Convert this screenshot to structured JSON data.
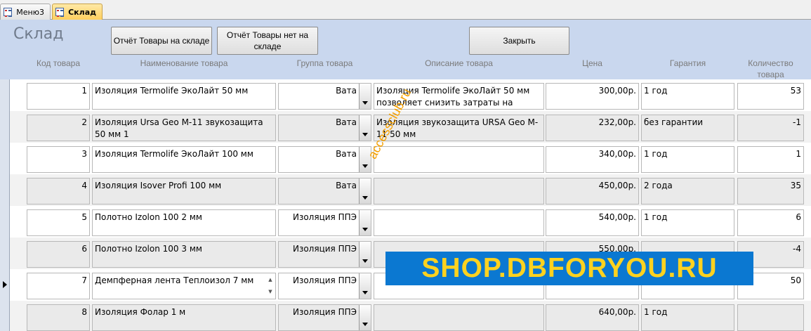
{
  "tabs": [
    {
      "label": "Меню3",
      "active": false
    },
    {
      "label": "Склад",
      "active": true
    }
  ],
  "form": {
    "title": "Склад",
    "buttons": {
      "report_in_stock": "Отчёт Товары на складе",
      "report_out_of_stock": "Отчёт Товары нет на складе",
      "close": "Закрыть"
    },
    "columns": {
      "code": "Код товара",
      "name": "Наименование товара",
      "group": "Группа товара",
      "description": "Описание товара",
      "price": "Цена",
      "warranty": "Гарантия",
      "quantity": "Количество товара"
    }
  },
  "rows": [
    {
      "code": "1",
      "name": "Изоляция Termolife ЭкоЛайт 50 мм",
      "group": "Вата",
      "description": "Изоляция Termolife ЭкоЛайт 50 мм  позволяет снизить затраты на",
      "price": "300,00р.",
      "warranty": "1 год",
      "quantity": "53"
    },
    {
      "code": "2",
      "name": "Изоляция Ursa Geo M-11 звукозащита 50 мм 1",
      "group": "Вата",
      "description": "Изоляция звукозащита URSA Geo M-11 50 мм",
      "price": "232,00р.",
      "warranty": "без гарантии",
      "quantity": "-1"
    },
    {
      "code": "3",
      "name": "Изоляция Termolife ЭкоЛайт 100 мм",
      "group": "Вата",
      "description": "",
      "price": "340,00р.",
      "warranty": "1 год",
      "quantity": "1"
    },
    {
      "code": "4",
      "name": "Изоляция Isover Profi 100 мм",
      "group": "Вата",
      "description": "",
      "price": "450,00р.",
      "warranty": "2 года",
      "quantity": "35"
    },
    {
      "code": "5",
      "name": "Полотно Izolon 100 2 мм",
      "group": "Изоляция ППЭ",
      "description": "",
      "price": "540,00р.",
      "warranty": "1 год",
      "quantity": "6"
    },
    {
      "code": "6",
      "name": "Полотно Izolon 100 3 мм",
      "group": "Изоляция ППЭ",
      "description": "",
      "price": "550,00р.",
      "warranty": "",
      "quantity": "-4"
    },
    {
      "code": "7",
      "name": "Демпферная лента Теплоизол 7 мм",
      "group": "Изоляция ППЭ",
      "description": "",
      "price": "",
      "warranty": "",
      "quantity": "50"
    },
    {
      "code": "8",
      "name": "Изоляция Фолар 1 м",
      "group": "Изоляция ППЭ",
      "description": "",
      "price": "640,00р.",
      "warranty": "1 год",
      "quantity": ""
    }
  ],
  "overlays": {
    "watermark": "accessclub.ru",
    "banner": "SHOP.DBFORYOU.RU",
    "banner_bg": "#0b78d1",
    "banner_text_color": "#ffd21f"
  }
}
